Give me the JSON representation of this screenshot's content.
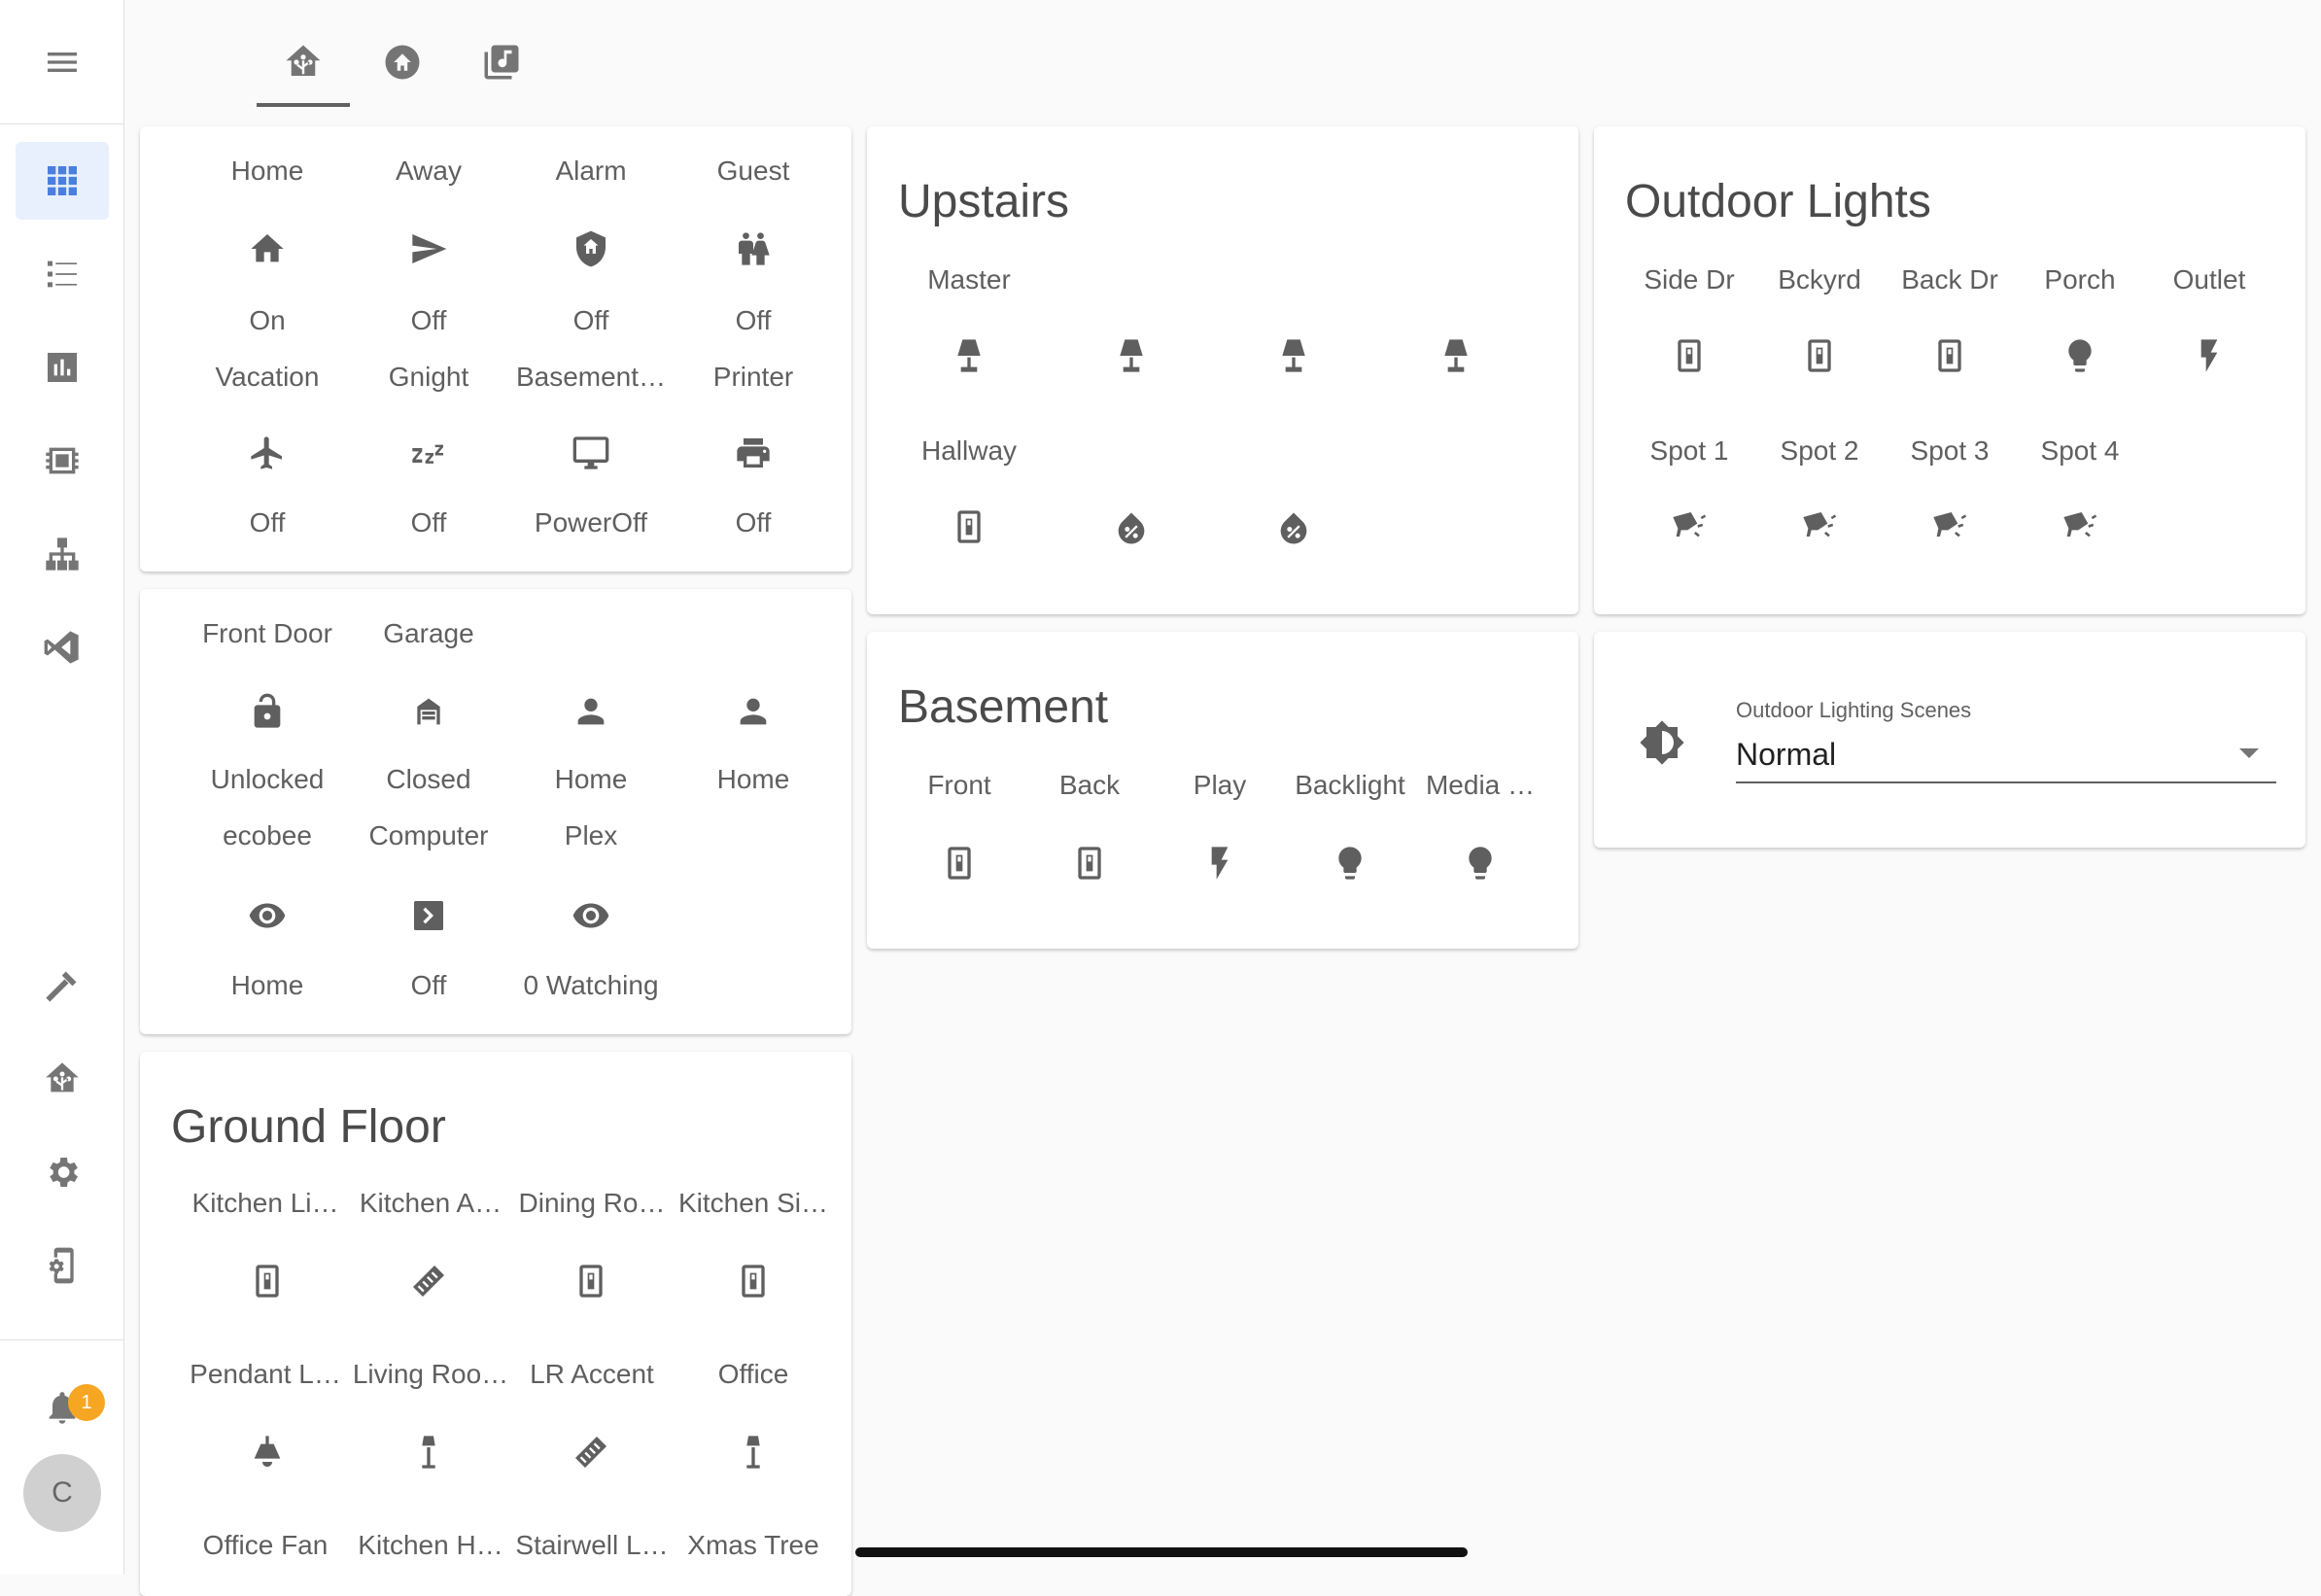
{
  "colors": {
    "accent": "#4a7fe0",
    "badge": "#f6a623",
    "icon": "#5f5f5f"
  },
  "sidebar": {
    "items": [
      {
        "name": "overview",
        "icon": "grid-icon",
        "active": true
      },
      {
        "name": "logbook",
        "icon": "list-icon"
      },
      {
        "name": "history",
        "icon": "bar-chart-icon"
      },
      {
        "name": "hacs",
        "icon": "chip-icon"
      },
      {
        "name": "network",
        "icon": "sitemap-icon"
      },
      {
        "name": "vscode",
        "icon": "vscode-icon"
      },
      {
        "name": "developer-tools",
        "icon": "hammer-icon"
      },
      {
        "name": "home-assistant",
        "icon": "home-assistant-icon"
      },
      {
        "name": "settings",
        "icon": "gear-icon"
      },
      {
        "name": "companion-app",
        "icon": "cellphone-cog-icon"
      }
    ],
    "notifications_badge": "1",
    "avatar_initial": "C"
  },
  "tabs": [
    {
      "icon": "home-assistant-icon",
      "active": true
    },
    {
      "icon": "home-circle-icon"
    },
    {
      "icon": "music-box-icon"
    }
  ],
  "modes_card": {
    "row1": [
      {
        "label": "Home",
        "icon": "home-icon",
        "state": "On"
      },
      {
        "label": "Away",
        "icon": "send-icon",
        "state": "Off"
      },
      {
        "label": "Alarm",
        "icon": "shield-home-icon",
        "state": "Off"
      },
      {
        "label": "Guest",
        "icon": "human-male-female-icon",
        "state": "Off"
      }
    ],
    "row2": [
      {
        "label": "Vacation",
        "icon": "airplane-icon",
        "state": "Off"
      },
      {
        "label": "Gnight",
        "icon": "sleep-icon",
        "state": "Off"
      },
      {
        "label": "Basement…",
        "icon": "monitor-icon",
        "state": "PowerOff"
      },
      {
        "label": "Printer",
        "icon": "printer-icon",
        "state": "Off"
      }
    ]
  },
  "status_card": {
    "row1": [
      {
        "label": "Front Door",
        "icon": "lock-open-icon",
        "state": "Unlocked"
      },
      {
        "label": "Garage",
        "icon": "garage-icon",
        "state": "Closed"
      },
      {
        "label": "",
        "icon": "person-icon",
        "state": "Home"
      },
      {
        "label": "",
        "icon": "person-icon",
        "state": "Home"
      }
    ],
    "row2": [
      {
        "label": "ecobee",
        "icon": "eye-icon",
        "state": "Home"
      },
      {
        "label": "Computer",
        "icon": "console-icon",
        "state": "Off"
      },
      {
        "label": "Plex",
        "icon": "eye-icon",
        "state": "0 Watching"
      }
    ]
  },
  "ground_floor": {
    "title": "Ground Floor",
    "row1": [
      {
        "label": "Kitchen Li…",
        "icon": "light-switch-icon"
      },
      {
        "label": "Kitchen A…",
        "icon": "led-strip-icon"
      },
      {
        "label": "Dining Ro…",
        "icon": "light-switch-icon"
      },
      {
        "label": "Kitchen Si…",
        "icon": "light-switch-icon"
      }
    ],
    "row2": [
      {
        "label": "Pendant L…",
        "icon": "ceiling-light-icon"
      },
      {
        "label": "Living Roo…",
        "icon": "floor-lamp-icon"
      },
      {
        "label": "LR Accent",
        "icon": "led-strip-icon"
      },
      {
        "label": "Office",
        "icon": "floor-lamp-icon"
      }
    ],
    "row3": [
      {
        "label": "Office Fan"
      },
      {
        "label": "Kitchen H…"
      },
      {
        "label": "Stairwell L…"
      },
      {
        "label": "Xmas Tree"
      }
    ]
  },
  "upstairs": {
    "title": "Upstairs",
    "row1": [
      {
        "label": "Master",
        "icon": "lamp-icon"
      },
      {
        "label": "",
        "icon": "lamp-icon"
      },
      {
        "label": "",
        "icon": "lamp-icon"
      },
      {
        "label": "",
        "icon": "lamp-icon"
      }
    ],
    "row2": [
      {
        "label": "Hallway",
        "icon": "light-switch-icon"
      },
      {
        "label": "",
        "icon": "water-percent-icon"
      },
      {
        "label": "",
        "icon": "water-percent-icon"
      }
    ]
  },
  "basement": {
    "title": "Basement",
    "row1": [
      {
        "label": "Front",
        "icon": "light-switch-icon"
      },
      {
        "label": "Back",
        "icon": "light-switch-icon"
      },
      {
        "label": "Play",
        "icon": "flash-icon"
      },
      {
        "label": "Backlight",
        "icon": "lightbulb-icon"
      },
      {
        "label": "Media …",
        "icon": "lightbulb-icon"
      }
    ]
  },
  "outdoor_lights": {
    "title": "Outdoor Lights",
    "row1": [
      {
        "label": "Side Dr",
        "icon": "light-switch-icon"
      },
      {
        "label": "Bckyrd",
        "icon": "light-switch-icon"
      },
      {
        "label": "Back Dr",
        "icon": "light-switch-icon"
      },
      {
        "label": "Porch",
        "icon": "lightbulb-icon"
      },
      {
        "label": "Outlet",
        "icon": "flash-icon"
      }
    ],
    "row2": [
      {
        "label": "Spot 1",
        "icon": "spotlight-icon"
      },
      {
        "label": "Spot 2",
        "icon": "spotlight-icon"
      },
      {
        "label": "Spot 3",
        "icon": "spotlight-icon"
      },
      {
        "label": "Spot 4",
        "icon": "spotlight-icon"
      }
    ]
  },
  "scenes": {
    "label": "Outdoor Lighting Scenes",
    "value": "Normal",
    "icon": "brightness-icon"
  }
}
